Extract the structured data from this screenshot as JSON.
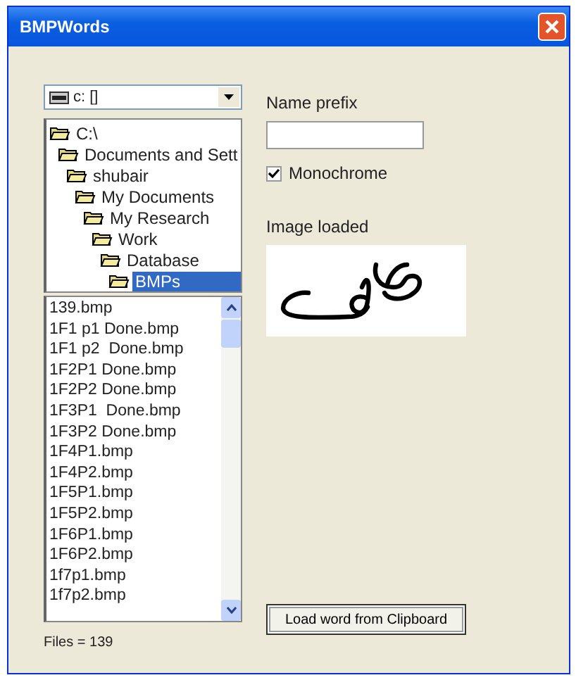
{
  "window": {
    "title": "BMPWords"
  },
  "drive_combo": {
    "value": "c: []"
  },
  "folder_tree": [
    {
      "label": "C:\\",
      "selected": false,
      "children": [
        {
          "label": "Documents and Sett",
          "selected": false,
          "children": [
            {
              "label": "shubair",
              "selected": false,
              "children": [
                {
                  "label": "My Documents",
                  "selected": false,
                  "children": [
                    {
                      "label": "My Research",
                      "selected": false,
                      "children": [
                        {
                          "label": "Work",
                          "selected": false,
                          "children": [
                            {
                              "label": "Database",
                              "selected": false,
                              "children": [
                                {
                                  "label": "BMPs",
                                  "selected": true
                                }
                              ]
                            }
                          ]
                        }
                      ]
                    }
                  ]
                }
              ]
            }
          ]
        }
      ]
    }
  ],
  "file_list": [
    "139.bmp",
    "1F1 p1 Done.bmp",
    "1F1 p2  Done.bmp",
    "1F2P1 Done.bmp",
    "1F2P2 Done.bmp",
    "1F3P1  Done.bmp",
    "1F3P2 Done.bmp",
    "1F4P1.bmp",
    "1F4P2.bmp",
    "1F5P1.bmp",
    "1F5P2.bmp",
    "1F6P1.bmp",
    "1F6P2.bmp",
    "1f7p1.bmp",
    "1f7p2.bmp"
  ],
  "file_count": "Files = 139",
  "name_prefix": {
    "label": "Name prefix"
  },
  "monochrome": {
    "label": "Monochrome",
    "checked": true
  },
  "image_label": "Image loaded",
  "load_button": "Load word from Clipboard"
}
